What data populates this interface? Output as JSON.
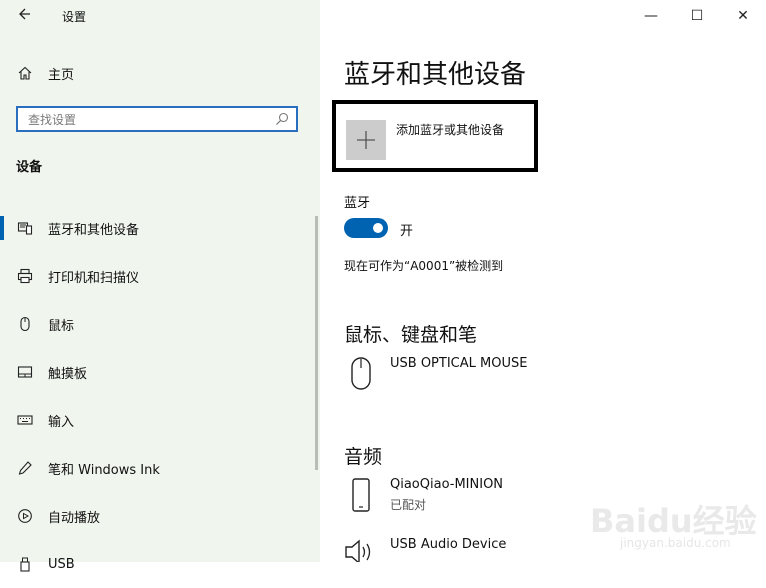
{
  "window": {
    "app_title": "设置",
    "back_icon": "back-arrow-icon",
    "minimize_glyph": "—",
    "maximize_glyph": "☐",
    "close_glyph": "✕"
  },
  "sidebar": {
    "home_label": "主页",
    "search_placeholder": "查找设置",
    "section_title": "设备",
    "items": [
      {
        "label": "蓝牙和其他设备",
        "icon": "bluetooth-devices-icon",
        "active": true
      },
      {
        "label": "打印机和扫描仪",
        "icon": "printer-icon",
        "active": false
      },
      {
        "label": "鼠标",
        "icon": "mouse-icon",
        "active": false
      },
      {
        "label": "触摸板",
        "icon": "touchpad-icon",
        "active": false
      },
      {
        "label": "输入",
        "icon": "keyboard-icon",
        "active": false
      },
      {
        "label": "笔和 Windows Ink",
        "icon": "pen-icon",
        "active": false
      },
      {
        "label": "自动播放",
        "icon": "autoplay-icon",
        "active": false
      },
      {
        "label": "USB",
        "icon": "usb-icon",
        "active": false
      }
    ]
  },
  "main": {
    "page_title": "蓝牙和其他设备",
    "add_device_label": "添加蓝牙或其他设备",
    "bluetooth_label": "蓝牙",
    "bluetooth_state": "开",
    "discoverable_text": "现在可作为“A0001”被检测到",
    "mouse_section_title": "鼠标、键盘和笔",
    "mouse_devices": [
      {
        "name": "USB OPTICAL MOUSE",
        "status": ""
      }
    ],
    "audio_section_title": "音频",
    "audio_devices": [
      {
        "name": "QiaoQiao-MINION",
        "status": "已配对"
      },
      {
        "name": "USB Audio Device",
        "status": ""
      }
    ]
  },
  "watermark": {
    "logo": "Baidu经验",
    "sub": "jingyan.baidu.com"
  },
  "colors": {
    "accent": "#0063b1",
    "sidebar_bg": "#f0f5ee",
    "search_border": "#2a6ebf"
  }
}
